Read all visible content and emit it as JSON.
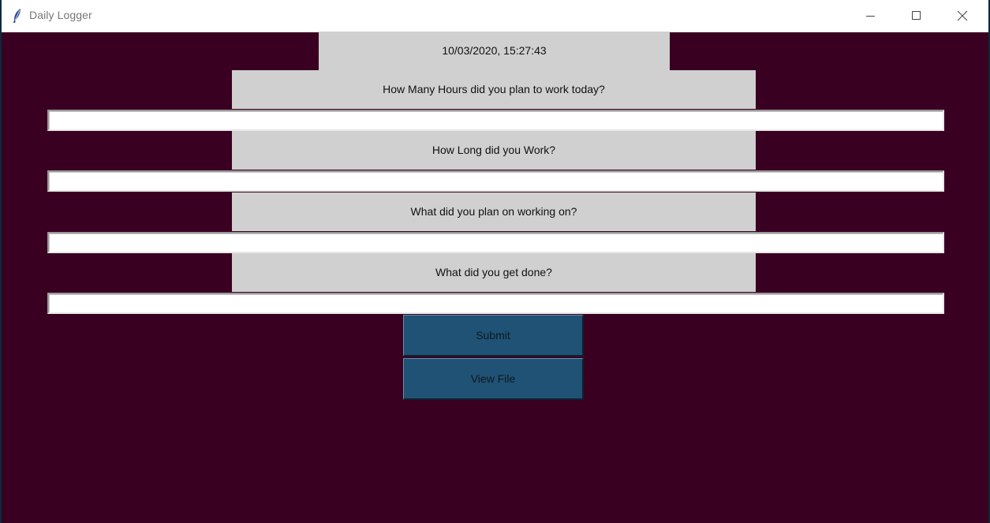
{
  "window": {
    "title": "Daily Logger"
  },
  "form": {
    "timestamp": "10/03/2020, 15:27:43",
    "questions": [
      {
        "label": "How Many Hours did you plan to work today?",
        "value": ""
      },
      {
        "label": "How Long did you Work?",
        "value": ""
      },
      {
        "label": "What did you plan on working on?",
        "value": ""
      },
      {
        "label": "What did you get done?",
        "value": ""
      }
    ]
  },
  "buttons": {
    "submit": "Submit",
    "view_file": "View File"
  },
  "colors": {
    "background": "#3a0021",
    "label_bg": "#d0d0d0",
    "button_bg": "#1f5274"
  }
}
